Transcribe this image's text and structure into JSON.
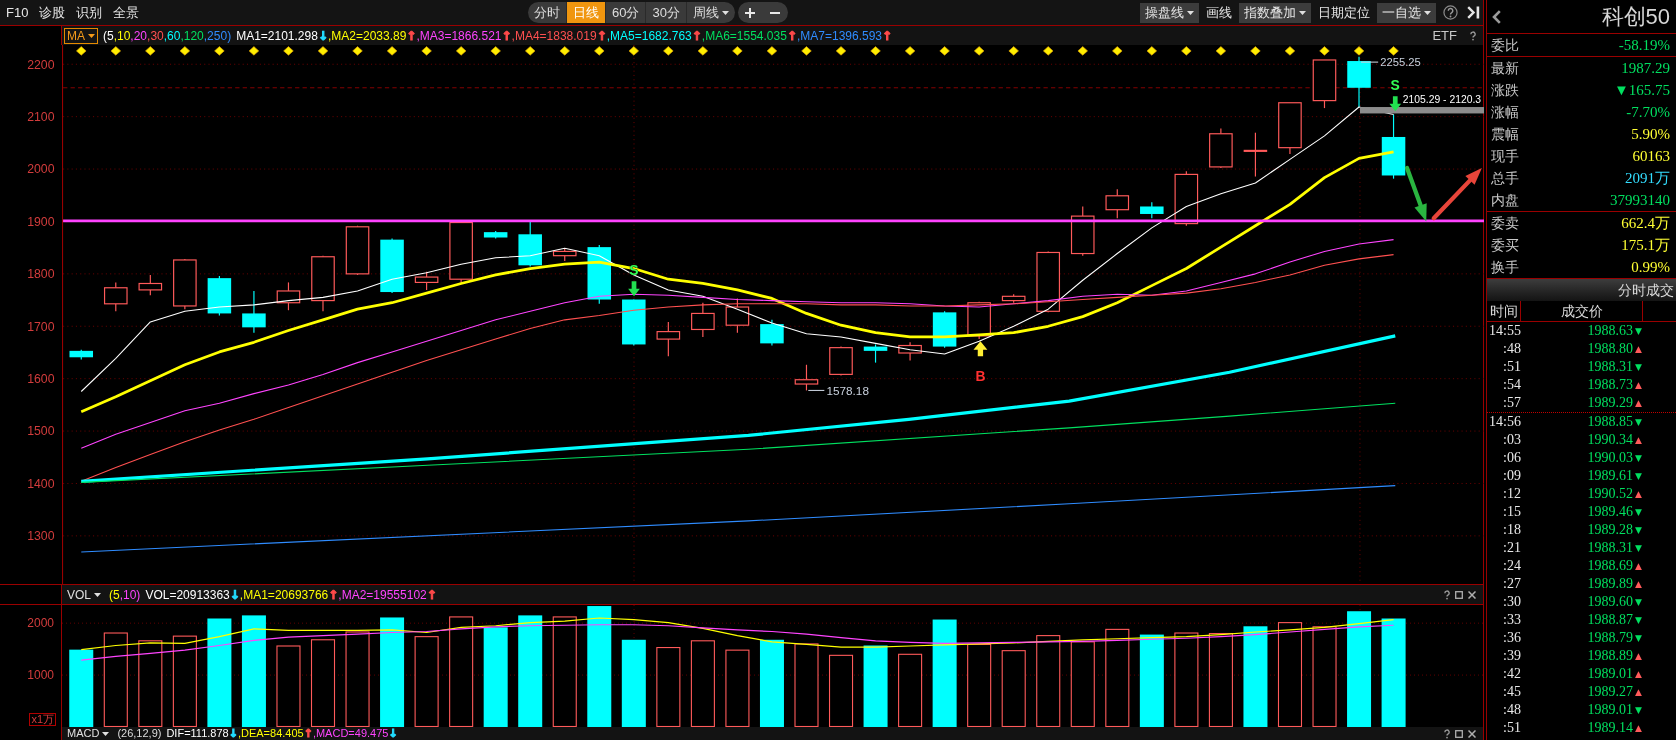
{
  "toolbar": {
    "links": [
      {
        "label": "F10"
      },
      {
        "label": "诊股"
      },
      {
        "label": "识别"
      },
      {
        "label": "全景"
      }
    ],
    "periods": [
      {
        "label": "分时",
        "selected": false,
        "dropdown": false
      },
      {
        "label": "日线",
        "selected": true,
        "dropdown": false
      },
      {
        "label": "60分",
        "selected": false,
        "dropdown": false
      },
      {
        "label": "30分",
        "selected": false,
        "dropdown": false
      },
      {
        "label": "周线",
        "selected": false,
        "dropdown": true
      }
    ],
    "tools": [
      {
        "label": "操盘线",
        "kind": "dropdown"
      },
      {
        "label": "画线",
        "kind": "link"
      },
      {
        "label": "指数叠加",
        "kind": "dropdown"
      },
      {
        "label": "日期定位",
        "kind": "link"
      },
      {
        "label": "一自选",
        "kind": "dropdown"
      }
    ]
  },
  "price_legend": {
    "label": "MA",
    "highlighted": true,
    "params": [
      {
        "text": "(5",
        "color": "#ffffff"
      },
      {
        "text": ",10",
        "color": "#ffff00"
      },
      {
        "text": ",20",
        "color": "#ff44ff"
      },
      {
        "text": ",30",
        "color": "#ff5050"
      },
      {
        "text": ",60",
        "color": "#00ffff"
      },
      {
        "text": ",120",
        "color": "#00e060"
      },
      {
        "text": ",250)",
        "color": "#2f8cff"
      }
    ],
    "values": [
      {
        "text": "MA1=2101.298",
        "color": "#ffffff",
        "arrow": {
          "text": "↓",
          "color": "#22ddff"
        }
      },
      {
        "text": ",MA2=2033.89",
        "color": "#ffff00",
        "arrow": {
          "text": "↑",
          "color": "#ff4a4a"
        }
      },
      {
        "text": ",MA3=1866.521",
        "color": "#ff44ff",
        "arrow": {
          "text": "↑",
          "color": "#ff4a4a"
        }
      },
      {
        "text": ",MA4=1838.019",
        "color": "#ff5050",
        "arrow": {
          "text": "↑",
          "color": "#ff4a4a"
        }
      },
      {
        "text": ",MA5=1682.763",
        "color": "#00ffff",
        "arrow": {
          "text": "↑",
          "color": "#ff4a4a"
        }
      },
      {
        "text": ",MA6=1554.035",
        "color": "#00e060",
        "arrow": {
          "text": "↑",
          "color": "#ff4a4a"
        }
      },
      {
        "text": ",MA7=1396.593",
        "color": "#2f8cff",
        "arrow": {
          "text": "↑",
          "color": "#ff4a4a"
        }
      }
    ],
    "tag": "ETF"
  },
  "price_chart": {
    "axis_labels": [
      "2200",
      "2100",
      "2000",
      "1900",
      "1800",
      "1700",
      "1600",
      "1500",
      "1400",
      "1300"
    ],
    "annotations": [
      {
        "text": "2255.25"
      },
      {
        "text": "1578.18"
      },
      {
        "text": "2105.29 - 2120.3"
      }
    ],
    "signals": [
      {
        "label": "S"
      },
      {
        "label": "B"
      },
      {
        "label": "S"
      }
    ]
  },
  "volume_legend": {
    "label": "VOL",
    "highlighted": false,
    "params": [
      {
        "text": "(5",
        "color": "#ffff00"
      },
      {
        "text": ",10)",
        "color": "#ff44ff"
      }
    ],
    "values": [
      {
        "text": "VOL=20913363",
        "color": "#ffffff",
        "arrow": {
          "text": "↓",
          "color": "#22ddff"
        }
      },
      {
        "text": ",MA1=20693766",
        "color": "#ffff00",
        "arrow": {
          "text": "↑",
          "color": "#ff4a4a"
        }
      },
      {
        "text": ",MA2=19555102",
        "color": "#ff44ff",
        "arrow": {
          "text": "↑",
          "color": "#ff4a4a"
        }
      }
    ]
  },
  "volume_chart": {
    "axis_labels": [
      "2000",
      "1000"
    ],
    "unit": "x1万"
  },
  "macd_legend": {
    "label": "MACD",
    "highlighted": false,
    "params": [
      {
        "text": "(26,12,9)",
        "color": "#dddddd"
      }
    ],
    "values": [
      {
        "text": "DIF=111.878",
        "color": "#ffffff",
        "arrow": {
          "text": "↓",
          "color": "#22ddff"
        }
      },
      {
        "text": ",DEA=84.405",
        "color": "#ffff00",
        "arrow": {
          "text": "↑",
          "color": "#ff4a4a"
        }
      },
      {
        "text": ",MACD=49.475",
        "color": "#ff44ff",
        "arrow": {
          "text": "↓",
          "color": "#22ddff"
        }
      }
    ]
  },
  "quote_panel": {
    "title": "科创50",
    "sections": [
      [
        {
          "label": "委比",
          "value": "-58.19%",
          "color": "#00e060"
        }
      ],
      [
        {
          "label": "最新",
          "value": "1987.29",
          "color": "#00e060"
        },
        {
          "label": "涨跌",
          "value": "▼165.75",
          "color": "#00e060"
        },
        {
          "label": "涨幅",
          "value": "-7.70%",
          "color": "#00e060"
        },
        {
          "label": "震幅",
          "value": "5.90%",
          "color": "#ffff33"
        },
        {
          "label": "现手",
          "value": "60163",
          "color": "#ffff33"
        },
        {
          "label": "总手",
          "value": "2091万",
          "color": "#33ddff"
        },
        {
          "label": "内盘",
          "value": "37993140",
          "color": "#00e060"
        }
      ],
      [
        {
          "label": "委卖",
          "value": "662.4万",
          "color": "#ffff33"
        },
        {
          "label": "委买",
          "value": "175.1万",
          "color": "#ffff33"
        },
        {
          "label": "换手",
          "value": "0.99%",
          "color": "#ffff33"
        }
      ]
    ],
    "trades": {
      "title": "分时成交",
      "columns": [
        "时间",
        "成交价"
      ],
      "minutes": [
        {
          "rows": [
            {
              "time": "14:55",
              "price": "1988.63",
              "arrow": {
                "text": "▼",
                "color": "#00e060"
              }
            },
            {
              "time": ":48",
              "price": "1988.80",
              "arrow": {
                "text": "▲",
                "color": "#ff5a5a"
              }
            },
            {
              "time": ":51",
              "price": "1988.31",
              "arrow": {
                "text": "▼",
                "color": "#00e060"
              }
            },
            {
              "time": ":54",
              "price": "1988.73",
              "arrow": {
                "text": "▲",
                "color": "#ff5a5a"
              }
            },
            {
              "time": ":57",
              "price": "1989.29",
              "arrow": {
                "text": "▲",
                "color": "#ff5a5a"
              }
            }
          ]
        },
        {
          "rows": [
            {
              "time": "14:56",
              "price": "1988.85",
              "arrow": {
                "text": "▼",
                "color": "#00e060"
              }
            },
            {
              "time": ":03",
              "price": "1990.34",
              "arrow": {
                "text": "▲",
                "color": "#ff5a5a"
              }
            },
            {
              "time": ":06",
              "price": "1990.03",
              "arrow": {
                "text": "▼",
                "color": "#00e060"
              }
            },
            {
              "time": ":09",
              "price": "1989.61",
              "arrow": {
                "text": "▼",
                "color": "#00e060"
              }
            },
            {
              "time": ":12",
              "price": "1990.52",
              "arrow": {
                "text": "▲",
                "color": "#ff5a5a"
              }
            },
            {
              "time": ":15",
              "price": "1989.46",
              "arrow": {
                "text": "▼",
                "color": "#00e060"
              }
            },
            {
              "time": ":18",
              "price": "1989.28",
              "arrow": {
                "text": "▼",
                "color": "#00e060"
              }
            },
            {
              "time": ":21",
              "price": "1988.31",
              "arrow": {
                "text": "▼",
                "color": "#00e060"
              }
            },
            {
              "time": ":24",
              "price": "1988.69",
              "arrow": {
                "text": "▲",
                "color": "#ff5a5a"
              }
            },
            {
              "time": ":27",
              "price": "1989.89",
              "arrow": {
                "text": "▲",
                "color": "#ff5a5a"
              }
            },
            {
              "time": ":30",
              "price": "1989.60",
              "arrow": {
                "text": "▼",
                "color": "#00e060"
              }
            },
            {
              "time": ":33",
              "price": "1988.87",
              "arrow": {
                "text": "▼",
                "color": "#00e060"
              }
            },
            {
              "time": ":36",
              "price": "1988.79",
              "arrow": {
                "text": "▼",
                "color": "#00e060"
              }
            },
            {
              "time": ":39",
              "price": "1988.89",
              "arrow": {
                "text": "▲",
                "color": "#ff5a5a"
              }
            },
            {
              "time": ":42",
              "price": "1989.01",
              "arrow": {
                "text": "▲",
                "color": "#ff5a5a"
              }
            },
            {
              "time": ":45",
              "price": "1989.27",
              "arrow": {
                "text": "▲",
                "color": "#ff5a5a"
              }
            },
            {
              "time": ":48",
              "price": "1989.01",
              "arrow": {
                "text": "▼",
                "color": "#00e060"
              }
            },
            {
              "time": ":51",
              "price": "1989.14",
              "arrow": {
                "text": "▲",
                "color": "#ff5a5a"
              }
            }
          ]
        }
      ]
    }
  }
}
